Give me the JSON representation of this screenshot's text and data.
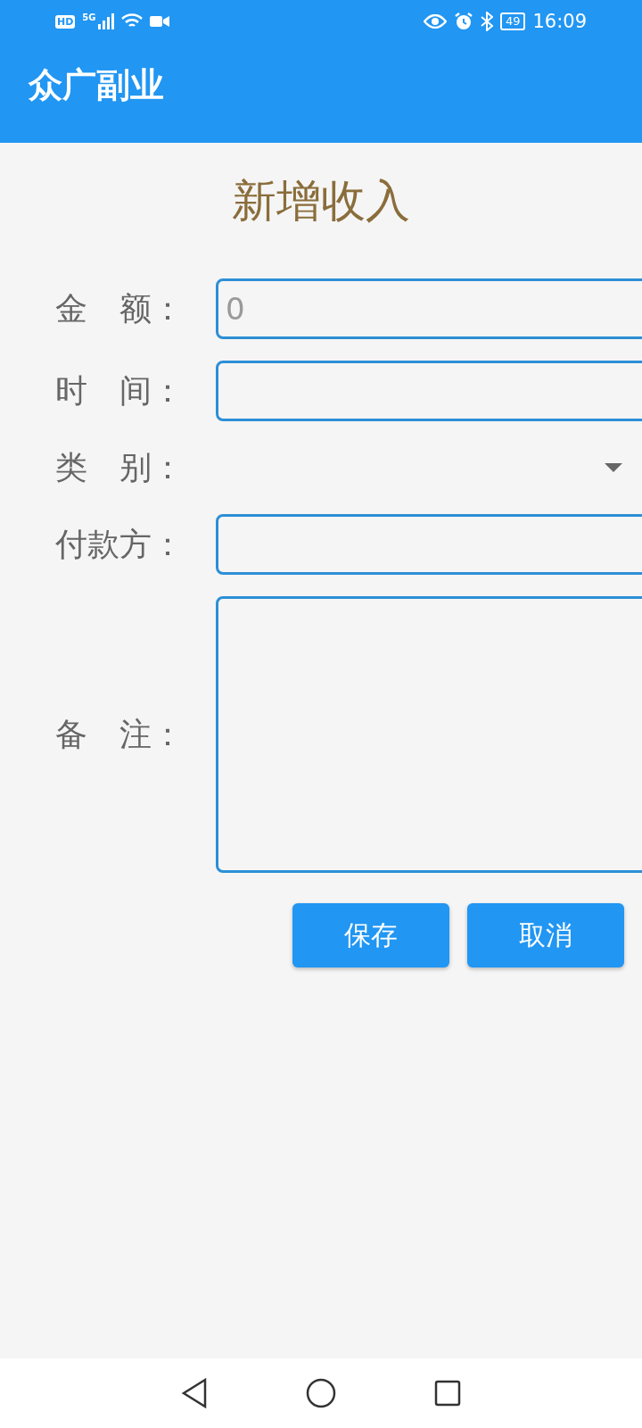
{
  "status_bar": {
    "hd": "HD",
    "network": "5G",
    "battery": "49",
    "time": "16:09"
  },
  "app_bar": {
    "title": "众广副业"
  },
  "form": {
    "title": "新增收入",
    "fields": [
      {
        "kind": "input",
        "label": "金　额：",
        "placeholder": "0"
      },
      {
        "kind": "input",
        "label": "时　间："
      },
      {
        "kind": "dropdown",
        "label": "类　别："
      },
      {
        "kind": "input",
        "label": "付款方："
      },
      {
        "kind": "textarea",
        "label": "备　注："
      }
    ],
    "buttons": [
      "保存",
      "取消"
    ]
  }
}
